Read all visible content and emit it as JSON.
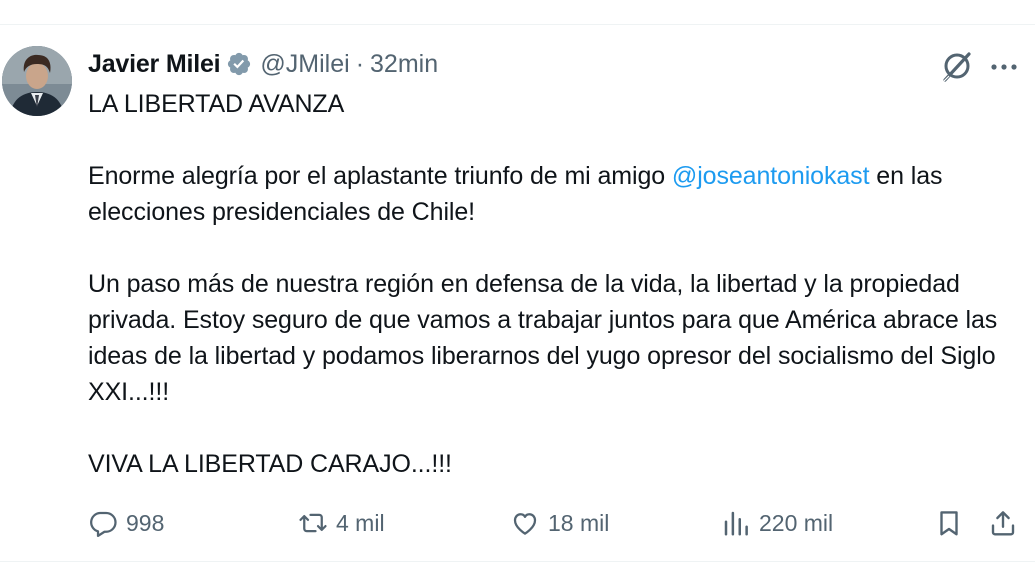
{
  "tweet": {
    "author_name": "Javier Milei",
    "handle": "@JMilei",
    "separator": "·",
    "time": "32min",
    "verified": true,
    "body": {
      "line1": "LA LIBERTAD AVANZA",
      "p2_before": "Enorme alegría por el aplastante triunfo de mi amigo ",
      "p2_mention": "@joseantoniokast",
      "p2_after": " en las elecciones presidenciales de Chile!",
      "p3": "Un paso más de nuestra región en defensa de la vida, la libertad y la propiedad privada. Estoy seguro de que vamos a trabajar juntos para que América abrace las ideas de la libertad y podamos liberarnos del yugo opresor del socialismo del Siglo XXI...!!!",
      "p4": "VIVA LA LIBERTAD CARAJO...!!!"
    },
    "actions": {
      "replies": "998",
      "retweets": "4 mil",
      "likes": "18 mil",
      "views": "220 mil"
    }
  },
  "colors": {
    "text": "#0f1419",
    "secondary": "#536471",
    "mention": "#1d9bf0",
    "verified_badge": "#829aab",
    "divider": "#eff3f4"
  },
  "icons": [
    "verified-badge-icon",
    "grok-icon",
    "more-icon",
    "reply-icon",
    "retweet-icon",
    "like-icon",
    "views-icon",
    "bookmark-icon",
    "share-icon"
  ]
}
